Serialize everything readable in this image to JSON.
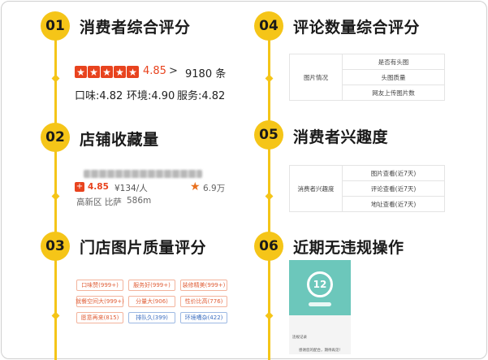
{
  "sections": {
    "s01": {
      "num": "01",
      "title": "消费者综合评分"
    },
    "s02": {
      "num": "02",
      "title": "店铺收藏量"
    },
    "s03": {
      "num": "03",
      "title": "门店图片质量评分"
    },
    "s04": {
      "num": "04",
      "title": "评论数量综合评分"
    },
    "s05": {
      "num": "05",
      "title": "消费者兴趣度"
    },
    "s06": {
      "num": "06",
      "title": "近期无违规操作"
    }
  },
  "rating": {
    "score": "4.85",
    "arrow": ">",
    "reviews": "9180 条",
    "taste": "口味:4.82",
    "env": "环境:4.90",
    "service": "服务:4.82"
  },
  "shop": {
    "score": "4.85",
    "price": "¥134/人",
    "district": "高新区 比萨",
    "distance": "586m",
    "favorites": "6.9万"
  },
  "tags": [
    {
      "label": "口味赞(999+)",
      "style": "red"
    },
    {
      "label": "服务好(999+)",
      "style": "red"
    },
    {
      "label": "装修精美(999+)",
      "style": "red"
    },
    {
      "label": "就餐空间大(999+)",
      "style": "red"
    },
    {
      "label": "分量大(906)",
      "style": "red"
    },
    {
      "label": "性价比高(776)",
      "style": "red"
    },
    {
      "label": "愿意再来(815)",
      "style": "red"
    },
    {
      "label": "排队久(399)",
      "style": "blue"
    },
    {
      "label": "环境嘈杂(422)",
      "style": "blue"
    }
  ],
  "comment_table": {
    "left": "图片情况",
    "rows": [
      "是否有头图",
      "头图质量",
      "网友上传图片数"
    ]
  },
  "interest_table": {
    "left": "消费者兴趣度",
    "rows": [
      "图片查看(近7天)",
      "评论查看(近7天)",
      "地址查看(近7天)"
    ]
  },
  "phone": {
    "number": "12",
    "line1": "违规记录",
    "line2": "感谢您的配合，期待再见！"
  },
  "colors": {
    "accent": "#f5c518",
    "red": "#e8431e",
    "blue": "#3d6fc0"
  }
}
